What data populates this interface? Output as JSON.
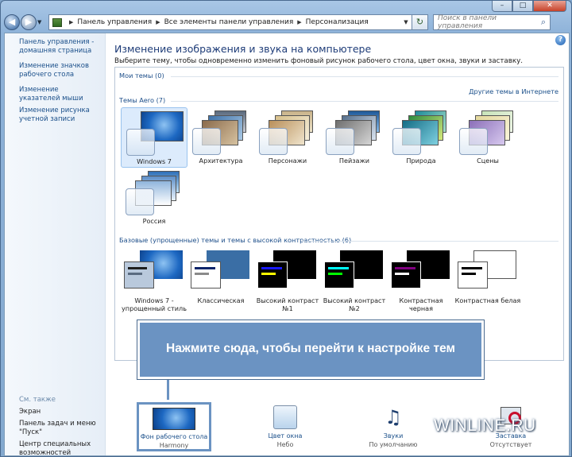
{
  "window": {
    "minimize_label": "–",
    "maximize_label": "□",
    "close_label": "✕"
  },
  "nav": {
    "back_glyph": "◀",
    "forward_glyph": "▶",
    "breadcrumbs": [
      "Панель управления",
      "Все элементы панели управления",
      "Персонализация"
    ],
    "refresh_glyph": "↻",
    "search_placeholder": "Поиск в панели управления"
  },
  "sidebar": {
    "items": [
      "Панель управления - домашняя страница",
      "Изменение значков рабочего стола",
      "Изменение указателей мыши",
      "Изменение рисунка учетной записи"
    ],
    "see_also_label": "См. также",
    "see_also": [
      "Экран",
      "Панель задач и меню \"Пуск\"",
      "Центр специальных возможностей"
    ]
  },
  "main": {
    "title": "Изменение изображения и звука на компьютере",
    "description": "Выберите тему, чтобы одновременно изменить фоновый рисунок рабочего стола, цвет окна, звуки и заставку.",
    "help_glyph": "?",
    "my_themes_label": "Мои темы (0)",
    "online_themes_link": "Другие темы в Интернете",
    "aero_label": "Темы Aero (7)",
    "aero_themes": [
      {
        "name": "Windows 7",
        "selected": true
      },
      {
        "name": "Архитектура"
      },
      {
        "name": "Персонажи"
      },
      {
        "name": "Пейзажи"
      },
      {
        "name": "Природа"
      },
      {
        "name": "Сцены"
      },
      {
        "name": "Россия"
      }
    ],
    "basic_label": "Базовые (упрощенные) темы и темы с высокой контрастностью (6)",
    "basic_themes": [
      {
        "name": "Windows 7 - упрощенный стиль"
      },
      {
        "name": "Классическая"
      },
      {
        "name": "Высокий контраст №1"
      },
      {
        "name": "Высокий контраст №2"
      },
      {
        "name": "Контрастная черная"
      },
      {
        "name": "Контрастная белая"
      }
    ]
  },
  "callout": {
    "text": "Нажмите сюда, чтобы перейти к настройке тем"
  },
  "bottom": {
    "items": [
      {
        "title": "Фон рабочего стола",
        "value": "Harmony"
      },
      {
        "title": "Цвет окна",
        "value": "Небо"
      },
      {
        "title": "Звуки",
        "value": "По умолчанию"
      },
      {
        "title": "Заставка",
        "value": "Отсутствует"
      }
    ]
  },
  "watermark": "WINLINE.RU",
  "colors": {
    "accent_link": "#1a4f8a",
    "title_blue": "#1e3c78",
    "callout_fill": "#6b93c2"
  }
}
